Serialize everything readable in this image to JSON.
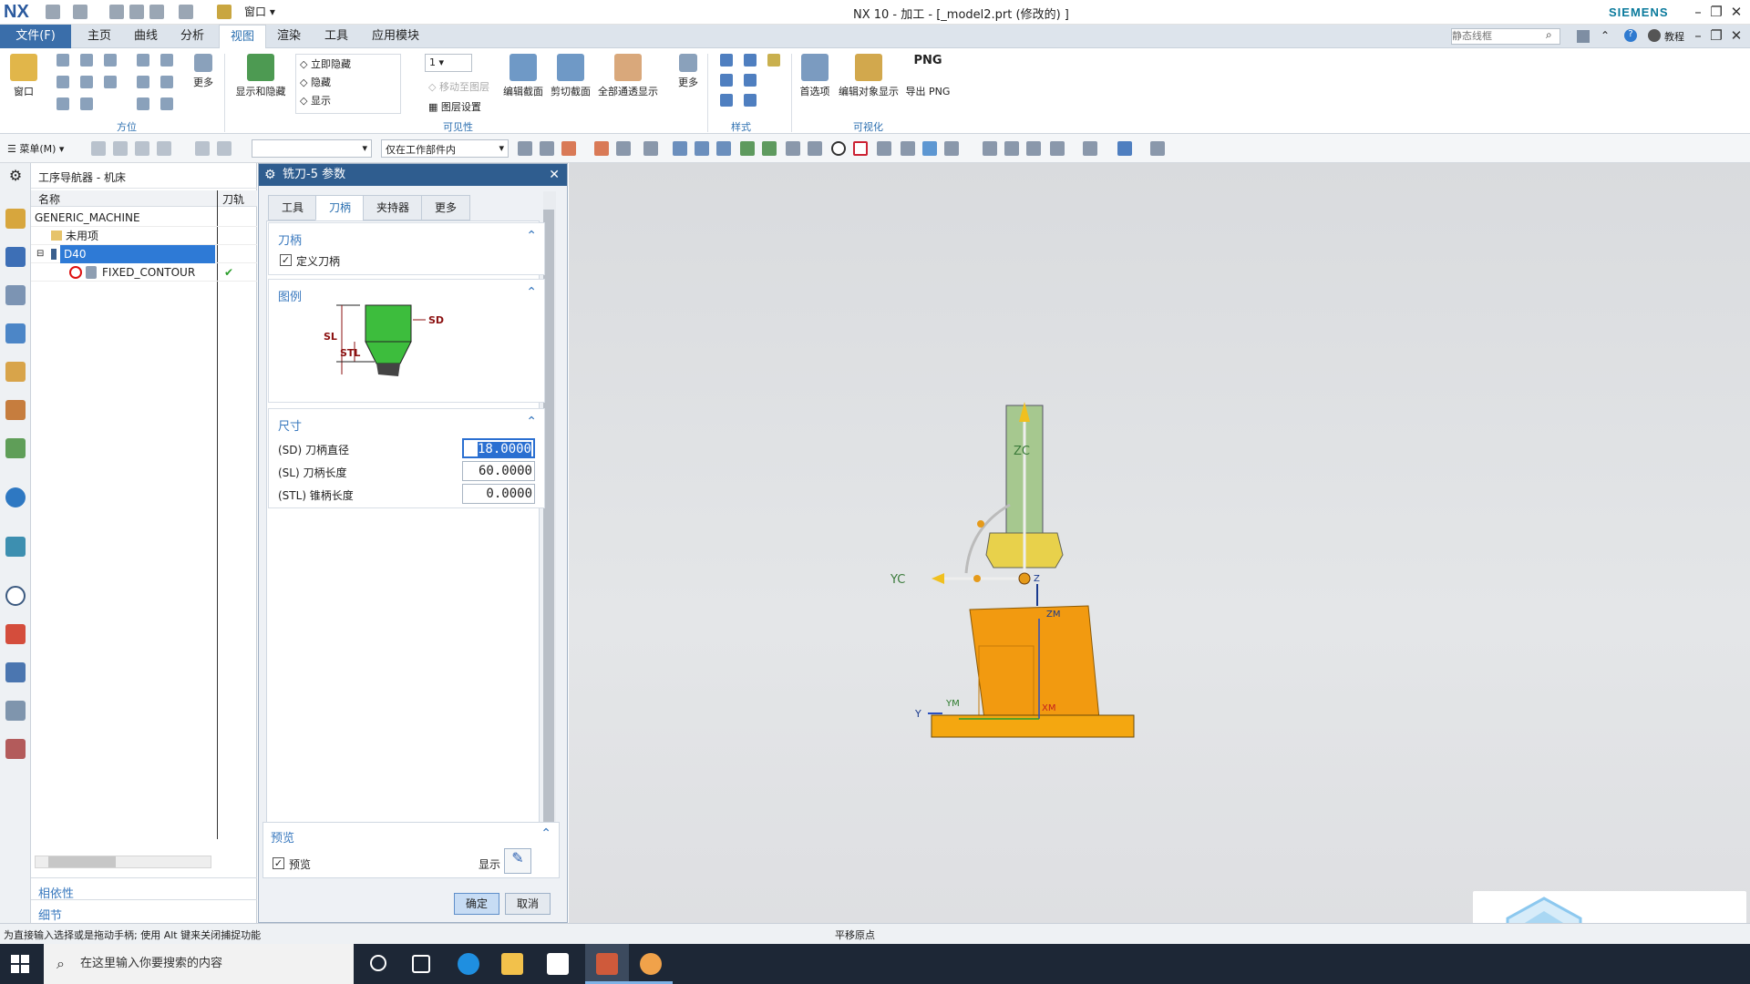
{
  "titlebar": {
    "logo": "NX",
    "window_menu": "窗口",
    "title": "NX 10 - 加工 - [_model2.prt  (修改的) ]",
    "brand": "SIEMENS",
    "search_placeholder": "静态线框",
    "tutorial": "教程"
  },
  "menubar": {
    "file": "文件(F)",
    "tabs": [
      "主页",
      "曲线",
      "分析",
      "视图",
      "渲染",
      "工具",
      "应用模块"
    ]
  },
  "ribbon": {
    "window_label": "窗口",
    "more1": "更多",
    "group_orient": "方位",
    "show_hide": "显示和隐藏",
    "immediate_hide": "立即隐藏",
    "hide": "隐藏",
    "show": "显示",
    "layer_value": "1",
    "move_to_layer": "移动至图层",
    "layer_settings": "图层设置",
    "group_visibility": "可见性",
    "edit_section": "编辑截面",
    "clip_section": "剪切截面",
    "full_pass_display": "全部通透显示",
    "more2": "更多",
    "group_style": "样式",
    "preferences": "首选项",
    "edit_object_display": "编辑对象显示",
    "png_top": "PNG",
    "export_png": "导出 PNG",
    "group_visualize": "可视化"
  },
  "toolbar2": {
    "menu": "菜单(M)",
    "filter_value": "",
    "scope_value": "仅在工作部件内"
  },
  "navigator": {
    "title": "工序导航器 - 机床",
    "col_name": "名称",
    "col_path": "刀轨",
    "rows": [
      {
        "name": "GENERIC_MACHINE"
      },
      {
        "name": "未用项"
      },
      {
        "name": "D40"
      },
      {
        "name": "FIXED_CONTOUR",
        "path": "✔"
      }
    ],
    "dependency": "相依性",
    "details": "细节"
  },
  "dialog": {
    "title": "铣刀-5 参数",
    "tabs": [
      "工具",
      "刀柄",
      "夹持器",
      "更多"
    ],
    "holder_section": "刀柄",
    "define_holder": "定义刀柄",
    "legend_section": "图例",
    "legend_sd": "SD",
    "legend_sl": "SL",
    "legend_stl": "STL",
    "size_section": "尺寸",
    "fields": [
      {
        "label": "(SD) 刀柄直径",
        "value": "18.0000"
      },
      {
        "label": "(SL) 刀柄长度",
        "value": "60.0000"
      },
      {
        "label": "(STL) 锥柄长度",
        "value": "0.0000"
      }
    ],
    "preview_section": "预览",
    "preview_check": "预览",
    "show_label": "显示",
    "ok": "确定",
    "cancel": "取消"
  },
  "viewport": {
    "zc": "ZC",
    "yc": "YC",
    "z": "Z",
    "zm": "ZM",
    "ym": "YM",
    "xm": "XM",
    "y": "Y"
  },
  "statusbar": {
    "left": "为直接输入选择或是拖动手柄; 使用 Alt 键来关闭捕捉功能",
    "center": "平移原点"
  },
  "taskbar": {
    "search_placeholder": "在这里输入你要搜索的内容"
  }
}
